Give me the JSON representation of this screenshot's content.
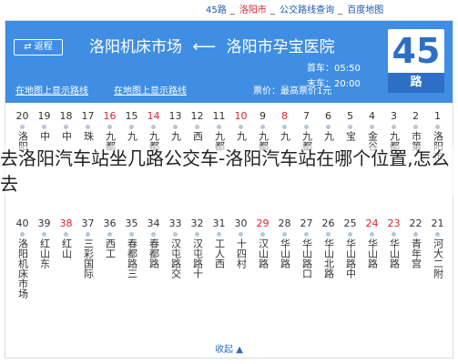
{
  "breadcrumb": {
    "items": [
      "45路",
      "洛阳市",
      "公交路线查询",
      "百度地图"
    ]
  },
  "header": {
    "route_number": "45",
    "route_suffix": "路",
    "return_button": "⇄ 返程",
    "from": "洛阳市孕宝医院",
    "to": "洛阳机床市场",
    "first_bus_label": "首车：05:50",
    "last_bus_label": "末车：20:00",
    "fare": "票价：最高票价1元",
    "link_left": "在地图上显示路线",
    "link_right": "在地图上显示路线"
  },
  "stops_top": [
    {
      "n": "1",
      "name": "洛阳市",
      "red": false
    },
    {
      "n": "2",
      "name": "市第",
      "red": false
    },
    {
      "n": "3",
      "name": "九都",
      "red": false
    },
    {
      "n": "4",
      "name": "金谷",
      "red": false
    },
    {
      "n": "5",
      "name": "宝",
      "red": false
    },
    {
      "n": "6",
      "name": "九",
      "red": false
    },
    {
      "n": "7",
      "name": "九都",
      "red": false
    },
    {
      "n": "8",
      "name": "九",
      "red": true
    },
    {
      "n": "9",
      "name": "九都",
      "red": false
    },
    {
      "n": "10",
      "name": "九",
      "red": true
    },
    {
      "n": "11",
      "name": "九都",
      "red": false
    },
    {
      "n": "12",
      "name": "西",
      "red": false
    },
    {
      "n": "13",
      "name": "九",
      "red": false
    },
    {
      "n": "14",
      "name": "九都",
      "red": true
    },
    {
      "n": "15",
      "name": "九",
      "red": false
    },
    {
      "n": "16",
      "name": "九都",
      "red": true
    },
    {
      "n": "17",
      "name": "珠",
      "red": false
    },
    {
      "n": "18",
      "name": "中",
      "red": false
    },
    {
      "n": "19",
      "name": "中",
      "red": false
    },
    {
      "n": "20",
      "name": "洛阳",
      "red": false
    }
  ],
  "stops_bottom": [
    {
      "n": "21",
      "name": "河大二附",
      "red": false
    },
    {
      "n": "22",
      "name": "青年宫",
      "red": false
    },
    {
      "n": "23",
      "name": "华山路",
      "red": true
    },
    {
      "n": "24",
      "name": "华山路",
      "red": true
    },
    {
      "n": "25",
      "name": "华山路中",
      "red": false
    },
    {
      "n": "26",
      "name": "华山北路",
      "red": false
    },
    {
      "n": "27",
      "name": "华山路口",
      "red": false
    },
    {
      "n": "28",
      "name": "华山路",
      "red": false
    },
    {
      "n": "29",
      "name": "汉山路",
      "red": true
    },
    {
      "n": "30",
      "name": "十四村",
      "red": false
    },
    {
      "n": "31",
      "name": "工人西",
      "red": false
    },
    {
      "n": "32",
      "name": "汉屯路十",
      "red": false
    },
    {
      "n": "33",
      "name": "汉屯路交",
      "red": false
    },
    {
      "n": "34",
      "name": "春都路",
      "red": false
    },
    {
      "n": "35",
      "name": "春都路三",
      "red": false
    },
    {
      "n": "36",
      "name": "西工",
      "red": false
    },
    {
      "n": "37",
      "name": "三彩国际",
      "red": false
    },
    {
      "n": "38",
      "name": "红山",
      "red": true
    },
    {
      "n": "39",
      "name": "红山东",
      "red": false
    },
    {
      "n": "40",
      "name": "洛阳机床市场",
      "red": false
    }
  ],
  "overlay_text": "去洛阳汽车站坐几路公交车-洛阳汽车站在哪个位置,怎么去",
  "collapse_label": "收起 ▲"
}
